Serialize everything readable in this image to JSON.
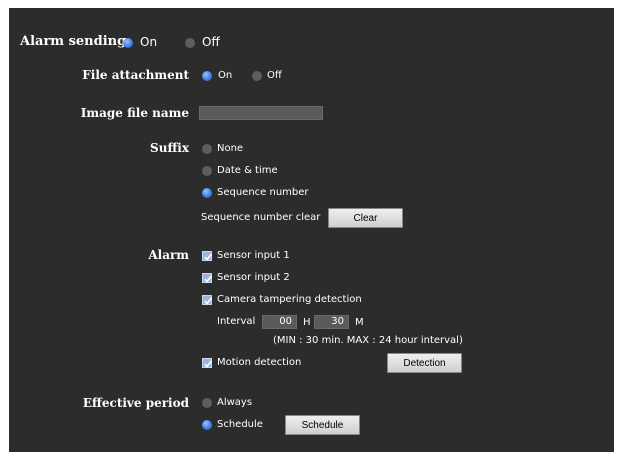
{
  "alarm_sending": {
    "label": "Alarm sending",
    "options": [
      "On",
      "Off"
    ],
    "selected": "On"
  },
  "file_attachment": {
    "label": "File attachment",
    "options": [
      "On",
      "Off"
    ],
    "selected": "On"
  },
  "image_file_name": {
    "label": "Image file name",
    "value": ""
  },
  "suffix": {
    "label": "Suffix",
    "options": [
      "None",
      "Date & time",
      "Sequence number"
    ],
    "selected": "Sequence number",
    "seq_clear_label": "Sequence number clear",
    "clear_button": "Clear"
  },
  "alarm": {
    "label": "Alarm",
    "sensor1": "Sensor input 1",
    "sensor2": "Sensor input 2",
    "tampering": "Camera tampering detection",
    "interval_label": "Interval",
    "interval_h": "00",
    "h_unit": "H",
    "interval_m": "30",
    "m_unit": "M",
    "interval_note": "(MIN : 30 min. MAX : 24 hour interval)",
    "motion": "Motion detection",
    "detection_button": "Detection"
  },
  "effective_period": {
    "label": "Effective period",
    "options": [
      "Always",
      "Schedule"
    ],
    "selected": "Schedule",
    "schedule_button": "Schedule"
  }
}
